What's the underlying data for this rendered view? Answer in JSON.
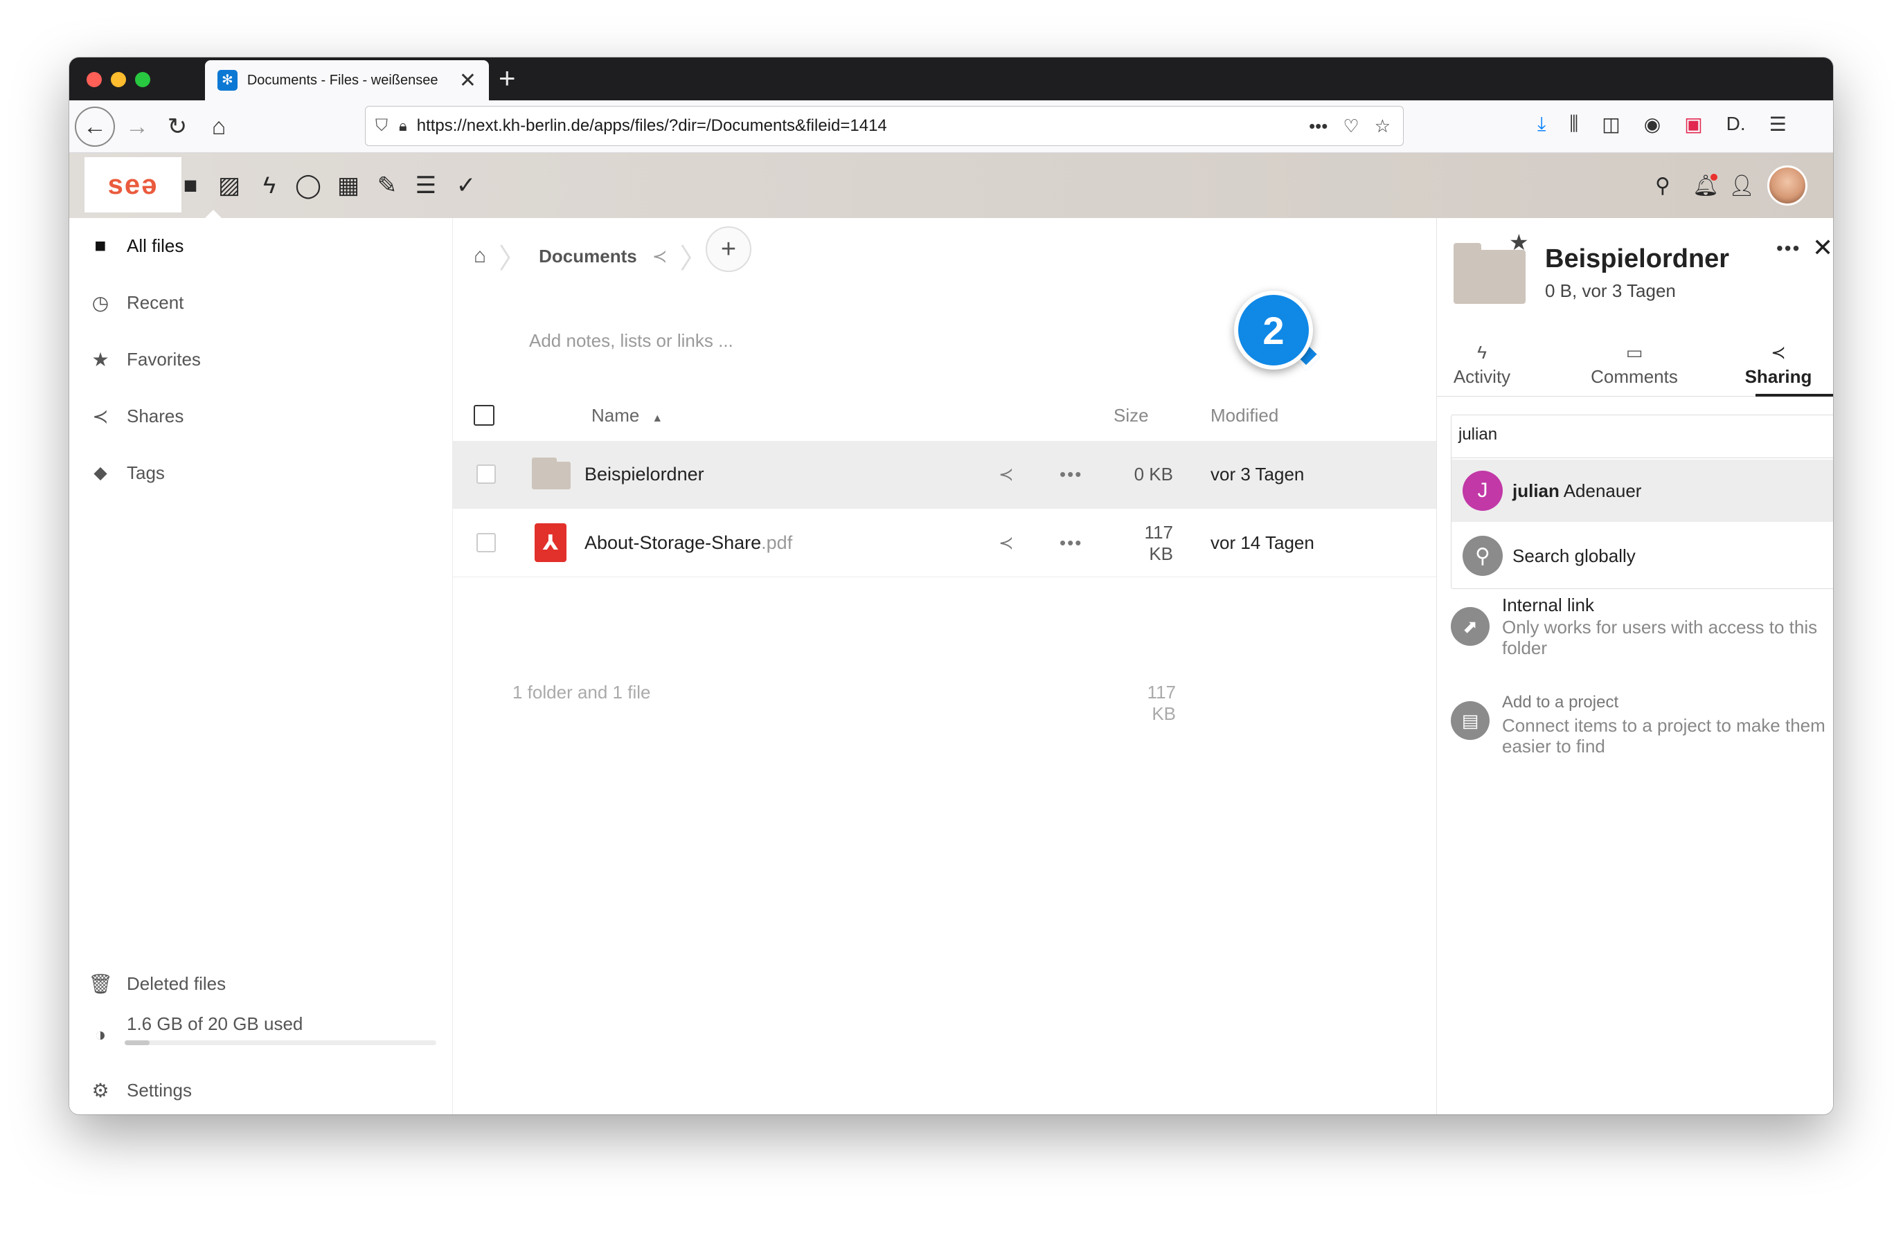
{
  "browser": {
    "tab_title": "Documents - Files - weißensee",
    "tab_close": "✕",
    "new_tab": "+",
    "url": "https://next.kh-berlin.de/apps/files/?dir=/Documents&fileid=1414"
  },
  "header": {
    "logo": "seə"
  },
  "sidebar": {
    "items": [
      {
        "label": "All files",
        "icon": "folder-icon"
      },
      {
        "label": "Recent",
        "icon": "clock-icon"
      },
      {
        "label": "Favorites",
        "icon": "star-icon"
      },
      {
        "label": "Shares",
        "icon": "share-icon"
      },
      {
        "label": "Tags",
        "icon": "tag-icon"
      }
    ],
    "deleted_files": "Deleted files",
    "quota": "1.6 GB of 20 GB used",
    "quota_fraction": 0.08,
    "settings": "Settings"
  },
  "files": {
    "breadcrumb": "Documents",
    "notes_placeholder": "Add notes, lists or links ...",
    "columns": {
      "name": "Name",
      "size": "Size",
      "modified": "Modified"
    },
    "rows": [
      {
        "name": "Beispielordner",
        "ext": "",
        "size": "0 KB",
        "modified": "vor 3 Tagen"
      },
      {
        "name": "About-Storage-Share",
        "ext": ".pdf",
        "size": "117 KB",
        "modified": "vor 14 Tagen"
      }
    ],
    "summary": "1 folder and 1 file",
    "summary_size": "117 KB"
  },
  "callout": {
    "number": "2"
  },
  "details": {
    "title": "Beispielordner",
    "meta": "0 B, vor 3 Tagen",
    "tabs": [
      {
        "label": "Activity"
      },
      {
        "label": "Comments"
      },
      {
        "label": "Sharing"
      }
    ],
    "search_value": "julian",
    "suggestions": [
      {
        "initial": "J",
        "bold": "julian",
        "rest": " Adenauer"
      },
      {
        "label": "Search globally"
      }
    ],
    "internal_link": {
      "title": "Internal link",
      "desc": "Only works for users with access to this folder"
    },
    "project": {
      "title": "Add to a project",
      "desc": "Connect items to a project to make them easier to find"
    }
  }
}
